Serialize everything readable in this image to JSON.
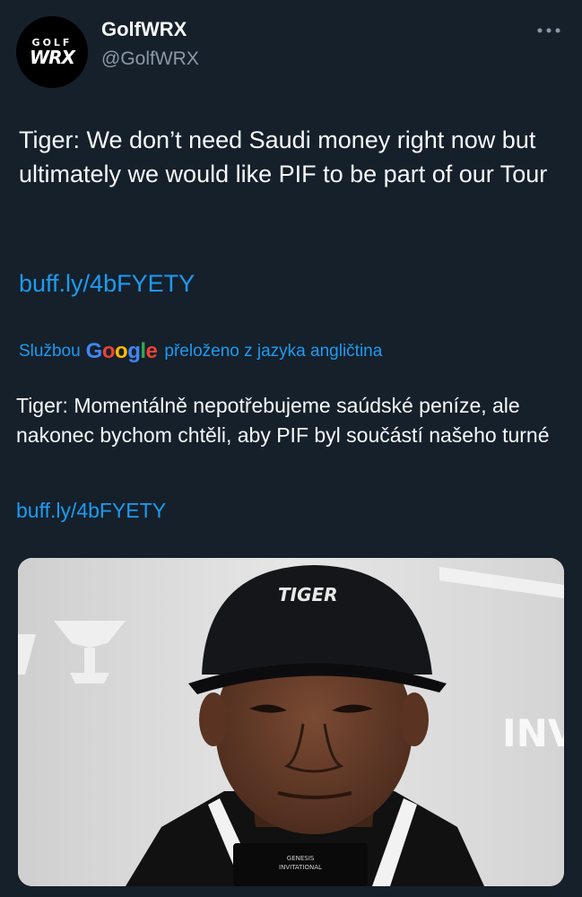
{
  "author": {
    "display_name": "GolfWRX",
    "handle": "@GolfWRX",
    "avatar_top": "GOLF",
    "avatar_bottom": "WRX",
    "more_icon": "more-horizontal-icon"
  },
  "tweet": {
    "text": "Tiger: We don’t need Saudi money right now but ultimately we would like PIF to be part of our Tour",
    "link": "buff.ly/4bFYETY"
  },
  "translation": {
    "prefix": "Službou",
    "provider_letters": [
      "G",
      "o",
      "o",
      "g",
      "l",
      "e"
    ],
    "suffix": "přeloženo z jazyka angličtina",
    "text": "Tiger: Momentálně nepotřebujeme saúdské peníze, ale nakonec bychom chtěli, aby PIF byl součástí našeho turné",
    "link": "buff.ly/4bFYETY"
  },
  "media": {
    "alt": "photo",
    "cap_logo": "TIGER",
    "backdrop_text": "INV",
    "mic_text_1": "GENESIS",
    "mic_text_2": "INVITATIONAL"
  },
  "colors": {
    "background": "#15202b",
    "text": "#f7f9f9",
    "secondary": "#8b98a5",
    "link": "#1d9bf0"
  }
}
